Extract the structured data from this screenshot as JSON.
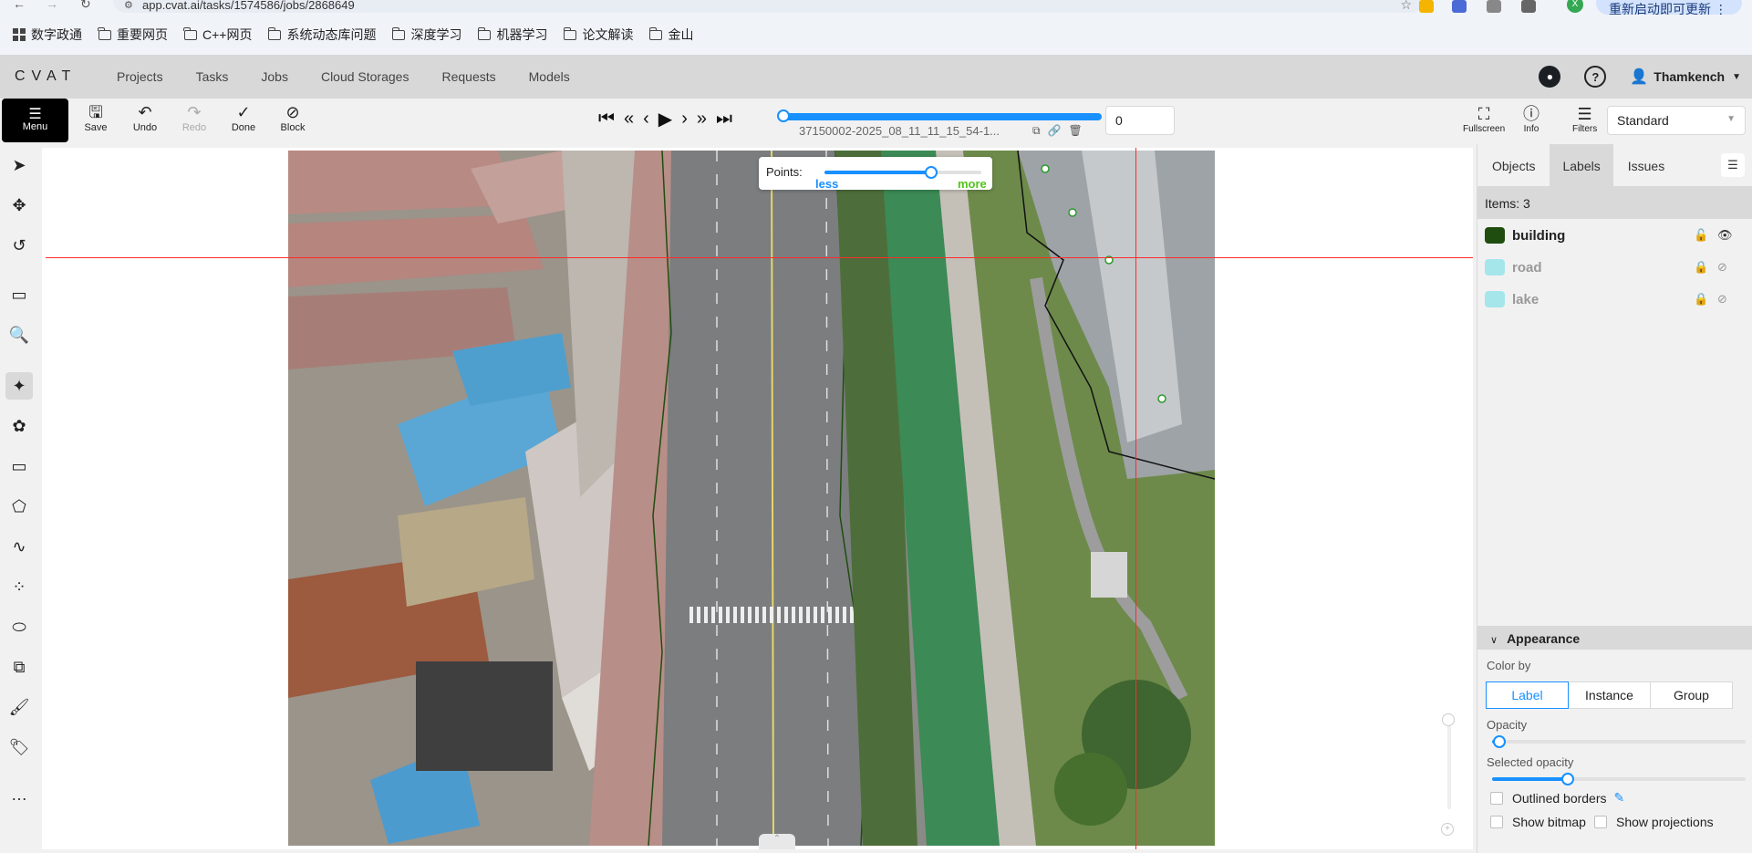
{
  "browser": {
    "url": "app.cvat.ai/tasks/1574586/jobs/2868649",
    "update_label": "重新启动即可更新",
    "profile_initial": "X",
    "bookmarks": [
      {
        "label": "数字政通",
        "icon": "grid-icon"
      },
      {
        "label": "重要网页",
        "icon": "folder-icon"
      },
      {
        "label": "C++网页",
        "icon": "folder-icon"
      },
      {
        "label": "系统动态库问题",
        "icon": "folder-icon"
      },
      {
        "label": "深度学习",
        "icon": "folder-icon"
      },
      {
        "label": "机器学习",
        "icon": "folder-icon"
      },
      {
        "label": "论文解读",
        "icon": "folder-icon"
      },
      {
        "label": "金山",
        "icon": "folder-icon"
      }
    ]
  },
  "header": {
    "logo": "CVAT",
    "nav": [
      "Projects",
      "Tasks",
      "Jobs",
      "Cloud Storages",
      "Requests",
      "Models"
    ],
    "user": "Thamkench"
  },
  "toolbar": {
    "menu_label": "Menu",
    "save_label": "Save",
    "undo_label": "Undo",
    "redo_label": "Redo",
    "done_label": "Done",
    "block_label": "Block",
    "frame_name": "37150002-2025_08_11_11_15_54-1...",
    "frame_number": "0",
    "fullscreen_label": "Fullscreen",
    "info_label": "Info",
    "filters_label": "Filters",
    "workspace": "Standard"
  },
  "canvas": {
    "points_label": "Points:",
    "points_less": "less",
    "points_more": "more",
    "points_level": 0.72
  },
  "right_panel": {
    "tabs": [
      "Objects",
      "Labels",
      "Issues"
    ],
    "active_tab": "Labels",
    "items_count": "Items: 3",
    "labels": [
      {
        "name": "building",
        "color": "#1f4d10",
        "locked": false,
        "visible": true
      },
      {
        "name": "road",
        "color": "#a5e6ea",
        "locked": true,
        "visible": false
      },
      {
        "name": "lake",
        "color": "#a5e6ea",
        "locked": true,
        "visible": false
      }
    ],
    "appearance": {
      "title": "Appearance",
      "color_by_label": "Color by",
      "color_by_options": [
        "Label",
        "Instance",
        "Group"
      ],
      "color_by_selected": "Label",
      "opacity_label": "Opacity",
      "opacity_value": 0.03,
      "selected_opacity_label": "Selected opacity",
      "selected_opacity_value": 0.3,
      "outlined_borders_label": "Outlined borders",
      "show_bitmap_label": "Show bitmap",
      "show_projections_label": "Show projections"
    }
  },
  "colors": {
    "accent": "#1890ff",
    "crosshair": "#ff2a2a",
    "points_more": "#52c41a"
  }
}
